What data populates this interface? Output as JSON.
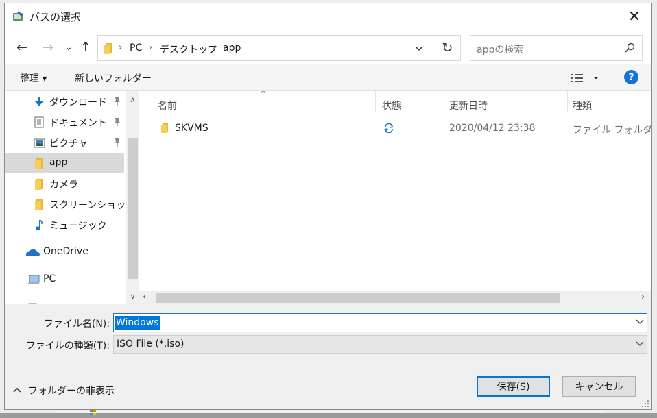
{
  "dialog": {
    "title": "パスの選択",
    "close_symbol": "✕"
  },
  "nav": {
    "back_symbol": "←",
    "forward_symbol": "→",
    "recent_symbol": "⌄",
    "up_symbol": "↑",
    "breadcrumbs": [
      "PC",
      "デスクトップ",
      "app"
    ],
    "crumb_separator": "›",
    "refresh_symbol": "↻",
    "search_placeholder": "appの検索"
  },
  "toolbar": {
    "organize_label": "整理 ▾",
    "new_folder_label": "新しいフォルダー",
    "help_symbol": "?"
  },
  "sidebar": {
    "items": [
      {
        "label": "ダウンロード",
        "icon": "download-arrow-icon",
        "pinned": true
      },
      {
        "label": "ドキュメント",
        "icon": "document-icon",
        "pinned": true
      },
      {
        "label": "ピクチャ",
        "icon": "pictures-icon",
        "pinned": true
      },
      {
        "label": "app",
        "icon": "folder-icon",
        "pinned": false,
        "selected": true
      },
      {
        "label": "カメラ",
        "icon": "folder-icon",
        "pinned": false
      },
      {
        "label": "スクリーンショット",
        "icon": "folder-icon",
        "pinned": false
      },
      {
        "label": "ミュージック",
        "icon": "music-note-icon",
        "pinned": false
      },
      {
        "label": "OneDrive",
        "icon": "cloud-icon",
        "pinned": false
      },
      {
        "label": "PC",
        "icon": "pc-icon",
        "pinned": false
      }
    ],
    "pin_symbol": "📌"
  },
  "file_list": {
    "columns": [
      "名前",
      "状態",
      "更新日時",
      "種類"
    ],
    "sort_indicator": "^",
    "rows": [
      {
        "name": "SKVMS",
        "status_icon": "sync-icon",
        "modified": "2020/04/12 23:38",
        "type": "ファイル フォルダー"
      }
    ]
  },
  "form": {
    "filename_label": "ファイル名(N):",
    "filename_value": "Windows",
    "filetype_label": "ファイルの種類(T):",
    "filetype_value": "ISO File (*.iso)"
  },
  "footer": {
    "hide_folders_label": "フォルダーの非表示",
    "save_label": "保存(S)",
    "cancel_label": "キャンセル"
  },
  "colors": {
    "accent": "#0078d7",
    "folder": "#e8b83a",
    "sync": "#1e73c8"
  }
}
